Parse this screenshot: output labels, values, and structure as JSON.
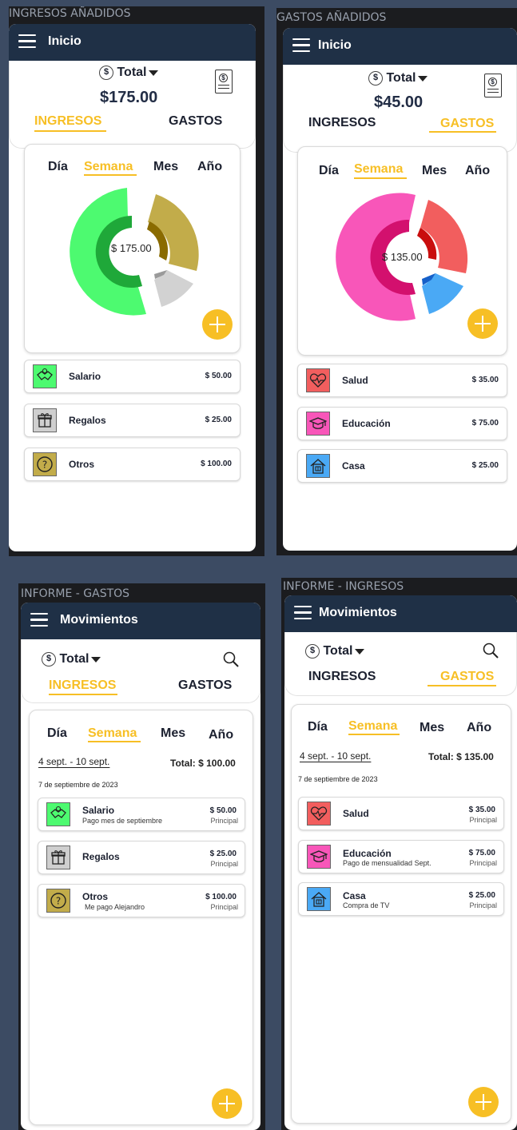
{
  "screens": [
    {
      "title": "INGRESOS AÑADIDOS",
      "header": "Inicio",
      "total_label": "Total",
      "total_amount": "$175.00",
      "tabs": [
        "INGRESOS",
        "GASTOS"
      ],
      "active_tab": "INGRESOS",
      "periods": [
        "Día",
        "Semana",
        "Mes",
        "Año"
      ],
      "active_period": "Semana",
      "chart_center": "$ 175.00",
      "items": [
        {
          "name": "Salario",
          "amount": "$ 50.00",
          "color": "#4dfa70",
          "icon": "handshake-icon"
        },
        {
          "name": "Regalos",
          "amount": "$ 25.00",
          "color": "#cfcfcf",
          "icon": "gift-icon"
        },
        {
          "name": "Otros",
          "amount": "$ 100.00",
          "color": "#c2ac4a",
          "icon": "question-icon"
        }
      ]
    },
    {
      "title": "GASTOS AÑADIDOS",
      "header": "Inicio",
      "total_label": "Total",
      "total_amount": "$45.00",
      "tabs": [
        "INGRESOS",
        "GASTOS"
      ],
      "active_tab": "GASTOS",
      "periods": [
        "Día",
        "Semana",
        "Mes",
        "Año"
      ],
      "active_period": "Semana",
      "chart_center": "$ 135.00",
      "items": [
        {
          "name": "Salud",
          "amount": "$ 35.00",
          "color": "#f25e5e",
          "icon": "heartbeat-icon"
        },
        {
          "name": "Educación",
          "amount": "$ 75.00",
          "color": "#f856b9",
          "icon": "graduation-cap-icon"
        },
        {
          "name": "Casa",
          "amount": "$ 25.00",
          "color": "#4aa9f5",
          "icon": "house-icon"
        }
      ]
    },
    {
      "title": "INFORME - GASTOS",
      "header": "Movimientos",
      "total_label": "Total",
      "tabs": [
        "INGRESOS",
        "GASTOS"
      ],
      "active_tab": "INGRESOS",
      "periods": [
        "Día",
        "Semana",
        "Mes",
        "Año"
      ],
      "active_period": "Semana",
      "range": "4 sept. - 10 sept.",
      "range_total": "Total: $ 100.00",
      "date": "7 de septiembre de 2023",
      "items": [
        {
          "name": "Salario",
          "sub": "Pago mes de septiembre",
          "amount": "$ 50.00",
          "account": "Principal",
          "color": "#4dfa70",
          "icon": "handshake-icon"
        },
        {
          "name": "Regalos",
          "sub": "",
          "amount": "$ 25.00",
          "account": "Principal",
          "color": "#cfcfcf",
          "icon": "gift-icon"
        },
        {
          "name": "Otros",
          "sub": "Me pago Alejandro",
          "amount": "$ 100.00",
          "account": "Principal",
          "color": "#c2ac4a",
          "icon": "question-icon"
        }
      ]
    },
    {
      "title": "INFORME - INGRESOS",
      "header": "Movimientos",
      "total_label": "Total",
      "tabs": [
        "INGRESOS",
        "GASTOS"
      ],
      "active_tab": "GASTOS",
      "periods": [
        "Día",
        "Semana",
        "Mes",
        "Año"
      ],
      "active_period": "Semana",
      "range": "4 sept. - 10 sept.",
      "range_total": "Total: $ 135.00",
      "date": "7 de septiembre de 2023",
      "items": [
        {
          "name": "Salud",
          "sub": "",
          "amount": "$ 35.00",
          "account": "Principal",
          "color": "#f25e5e",
          "icon": "heartbeat-icon"
        },
        {
          "name": "Educación",
          "sub": "Pago de mensualidad Sept.",
          "amount": "$ 75.00",
          "account": "Principal",
          "color": "#f856b9",
          "icon": "graduation-cap-icon"
        },
        {
          "name": "Casa",
          "sub": "Compra de TV",
          "amount": "$ 25.00",
          "account": "Principal",
          "color": "#4aa9f5",
          "icon": "house-icon"
        }
      ]
    }
  ],
  "colors": {
    "header": "#1f3046",
    "accent": "#f7bf25",
    "background": "#3c4b63"
  }
}
